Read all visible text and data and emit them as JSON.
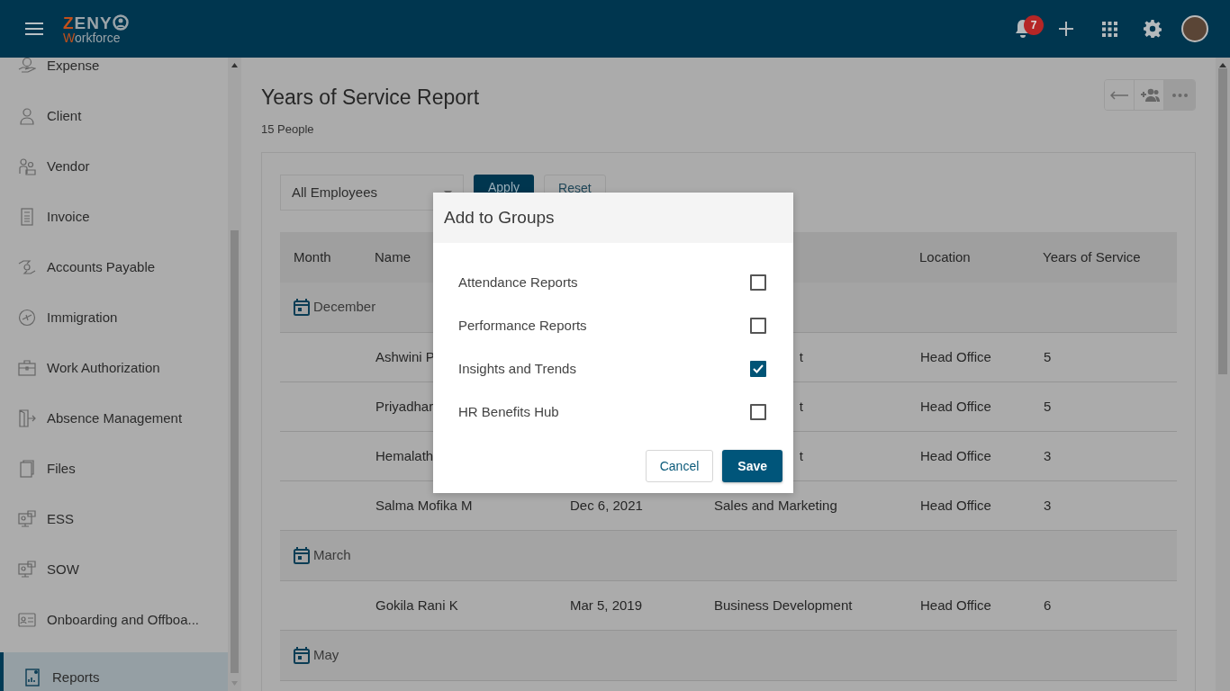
{
  "topbar": {
    "logo": {
      "text": "ZENY",
      "subtitle": "Workforce"
    },
    "notifications": {
      "count": "7"
    }
  },
  "sidebar": {
    "items": [
      {
        "label": "Expense",
        "selected": false
      },
      {
        "label": "Client",
        "selected": false
      },
      {
        "label": "Vendor",
        "selected": false
      },
      {
        "label": "Invoice",
        "selected": false
      },
      {
        "label": "Accounts Payable",
        "selected": false
      },
      {
        "label": "Immigration",
        "selected": false
      },
      {
        "label": "Work Authorization",
        "selected": false
      },
      {
        "label": "Absence Management",
        "selected": false
      },
      {
        "label": "Files",
        "selected": false
      },
      {
        "label": "ESS",
        "selected": false
      },
      {
        "label": "SOW",
        "selected": false
      },
      {
        "label": "Onboarding and Offboa...",
        "selected": false
      },
      {
        "label": "Reports",
        "selected": true
      }
    ]
  },
  "page": {
    "title": "Years of Service Report",
    "subtitle": "15 People"
  },
  "filters": {
    "select": {
      "value": "All Employees"
    },
    "buttons": [
      "Apply",
      "Reset"
    ]
  },
  "table": {
    "columns": [
      "Month",
      "Name",
      "Location",
      "Years of Service"
    ],
    "groups": [
      {
        "month": "December",
        "rows": [
          {
            "name": "Ashwini P",
            "covered": true,
            "department": "t",
            "location": "Head Office",
            "years": "5"
          },
          {
            "name": "Priyadhar",
            "covered": true,
            "department": "t",
            "location": "Head Office",
            "years": "5"
          },
          {
            "name": "Hemalath",
            "covered": true,
            "department": "t",
            "location": "Head Office",
            "years": "3"
          },
          {
            "name": "Salma Mofika M",
            "covered": false,
            "date": "Dec 6, 2021",
            "department": "Sales and Marketing",
            "location": "Head Office",
            "years": "3"
          }
        ]
      },
      {
        "month": "March",
        "rows": [
          {
            "name": "Gokila Rani K",
            "covered": false,
            "date": "Mar 5, 2019",
            "department": "Business Development",
            "location": "Head Office",
            "years": "6"
          }
        ]
      },
      {
        "month": "May"
      }
    ]
  },
  "dialog": {
    "title": "Add to Groups",
    "options": [
      {
        "label": "Attendance Reports",
        "checked": false
      },
      {
        "label": "Performance Reports",
        "checked": false
      },
      {
        "label": "Insights and Trends",
        "checked": true
      },
      {
        "label": "HR Benefits Hub",
        "checked": false
      }
    ],
    "buttons": [
      "Cancel",
      "Save"
    ]
  }
}
